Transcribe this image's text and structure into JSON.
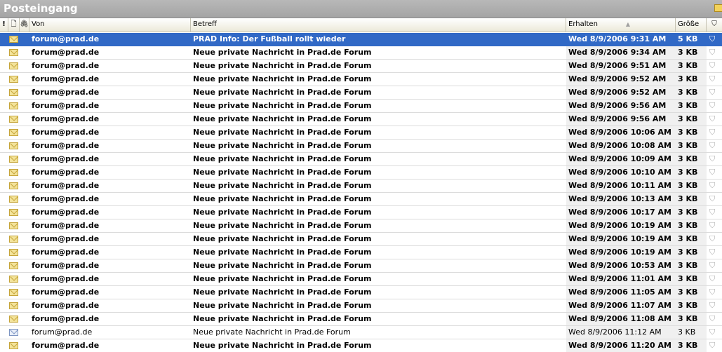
{
  "window": {
    "title": "Posteingang"
  },
  "columns": {
    "importance": "!",
    "icon": "🗋",
    "attachment": "🖇",
    "from": "Von",
    "subject": "Betreff",
    "received": "Erhalten",
    "size": "Größe",
    "flag": "⛉",
    "sort_indicator": "▲"
  },
  "messages": [
    {
      "from": "forum@prad.de",
      "subject": "PRAD Info: Der Fußball rollt wieder",
      "received": "Wed 8/9/2006 9:31 AM",
      "size": "5 KB",
      "unread": true,
      "selected": true
    },
    {
      "from": "forum@prad.de",
      "subject": "Neue private Nachricht in Prad.de Forum",
      "received": "Wed 8/9/2006 9:34 AM",
      "size": "3 KB",
      "unread": true,
      "selected": false
    },
    {
      "from": "forum@prad.de",
      "subject": "Neue private Nachricht in Prad.de Forum",
      "received": "Wed 8/9/2006 9:51 AM",
      "size": "3 KB",
      "unread": true,
      "selected": false
    },
    {
      "from": "forum@prad.de",
      "subject": "Neue private Nachricht in Prad.de Forum",
      "received": "Wed 8/9/2006 9:52 AM",
      "size": "3 KB",
      "unread": true,
      "selected": false
    },
    {
      "from": "forum@prad.de",
      "subject": "Neue private Nachricht in Prad.de Forum",
      "received": "Wed 8/9/2006 9:52 AM",
      "size": "3 KB",
      "unread": true,
      "selected": false
    },
    {
      "from": "forum@prad.de",
      "subject": "Neue private Nachricht in Prad.de Forum",
      "received": "Wed 8/9/2006 9:56 AM",
      "size": "3 KB",
      "unread": true,
      "selected": false
    },
    {
      "from": "forum@prad.de",
      "subject": "Neue private Nachricht in Prad.de Forum",
      "received": "Wed 8/9/2006 9:56 AM",
      "size": "3 KB",
      "unread": true,
      "selected": false
    },
    {
      "from": "forum@prad.de",
      "subject": "Neue private Nachricht in Prad.de Forum",
      "received": "Wed 8/9/2006 10:06 AM",
      "size": "3 KB",
      "unread": true,
      "selected": false
    },
    {
      "from": "forum@prad.de",
      "subject": "Neue private Nachricht in Prad.de Forum",
      "received": "Wed 8/9/2006 10:08 AM",
      "size": "3 KB",
      "unread": true,
      "selected": false
    },
    {
      "from": "forum@prad.de",
      "subject": "Neue private Nachricht in Prad.de Forum",
      "received": "Wed 8/9/2006 10:09 AM",
      "size": "3 KB",
      "unread": true,
      "selected": false
    },
    {
      "from": "forum@prad.de",
      "subject": "Neue private Nachricht in Prad.de Forum",
      "received": "Wed 8/9/2006 10:10 AM",
      "size": "3 KB",
      "unread": true,
      "selected": false
    },
    {
      "from": "forum@prad.de",
      "subject": "Neue private Nachricht in Prad.de Forum",
      "received": "Wed 8/9/2006 10:11 AM",
      "size": "3 KB",
      "unread": true,
      "selected": false
    },
    {
      "from": "forum@prad.de",
      "subject": "Neue private Nachricht in Prad.de Forum",
      "received": "Wed 8/9/2006 10:13 AM",
      "size": "3 KB",
      "unread": true,
      "selected": false
    },
    {
      "from": "forum@prad.de",
      "subject": "Neue private Nachricht in Prad.de Forum",
      "received": "Wed 8/9/2006 10:17 AM",
      "size": "3 KB",
      "unread": true,
      "selected": false
    },
    {
      "from": "forum@prad.de",
      "subject": "Neue private Nachricht in Prad.de Forum",
      "received": "Wed 8/9/2006 10:19 AM",
      "size": "3 KB",
      "unread": true,
      "selected": false
    },
    {
      "from": "forum@prad.de",
      "subject": "Neue private Nachricht in Prad.de Forum",
      "received": "Wed 8/9/2006 10:19 AM",
      "size": "3 KB",
      "unread": true,
      "selected": false
    },
    {
      "from": "forum@prad.de",
      "subject": "Neue private Nachricht in Prad.de Forum",
      "received": "Wed 8/9/2006 10:19 AM",
      "size": "3 KB",
      "unread": true,
      "selected": false
    },
    {
      "from": "forum@prad.de",
      "subject": "Neue private Nachricht in Prad.de Forum",
      "received": "Wed 8/9/2006 10:53 AM",
      "size": "3 KB",
      "unread": true,
      "selected": false
    },
    {
      "from": "forum@prad.de",
      "subject": "Neue private Nachricht in Prad.de Forum",
      "received": "Wed 8/9/2006 11:01 AM",
      "size": "3 KB",
      "unread": true,
      "selected": false
    },
    {
      "from": "forum@prad.de",
      "subject": "Neue private Nachricht in Prad.de Forum",
      "received": "Wed 8/9/2006 11:05 AM",
      "size": "3 KB",
      "unread": true,
      "selected": false
    },
    {
      "from": "forum@prad.de",
      "subject": "Neue private Nachricht in Prad.de Forum",
      "received": "Wed 8/9/2006 11:07 AM",
      "size": "3 KB",
      "unread": true,
      "selected": false
    },
    {
      "from": "forum@prad.de",
      "subject": "Neue private Nachricht in Prad.de Forum",
      "received": "Wed 8/9/2006 11:08 AM",
      "size": "3 KB",
      "unread": true,
      "selected": false
    },
    {
      "from": "forum@prad.de",
      "subject": "Neue private Nachricht in Prad.de Forum",
      "received": "Wed 8/9/2006 11:12 AM",
      "size": "3 KB",
      "unread": false,
      "selected": false
    },
    {
      "from": "forum@prad.de",
      "subject": "Neue private Nachricht in Prad.de Forum",
      "received": "Wed 8/9/2006 11:20 AM",
      "size": "3 KB",
      "unread": true,
      "selected": false
    }
  ],
  "icons": {
    "unread_message": "envelope-closed-icon",
    "read_message": "envelope-open-icon",
    "flag": "flag-icon"
  },
  "colors": {
    "selection": "#3169c6",
    "title_bar": "#a8a8a8",
    "header": "#ece9d8",
    "received_column_bg": "#f0f0f0"
  }
}
